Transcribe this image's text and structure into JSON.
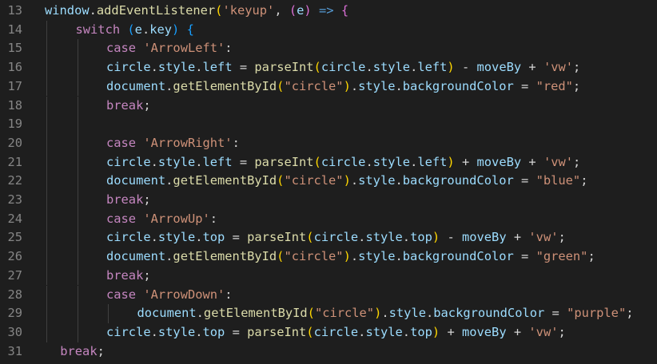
{
  "editor": {
    "first_line_number": 13,
    "lines": [
      {
        "num": "13",
        "indent": 0,
        "tokens": [
          {
            "t": "window",
            "c": "t-var"
          },
          {
            "t": ".",
            "c": "t-pun"
          },
          {
            "t": "addEventListener",
            "c": "t-fn"
          },
          {
            "t": "(",
            "c": "t-br1"
          },
          {
            "t": "'keyup'",
            "c": "t-str"
          },
          {
            "t": ", ",
            "c": "t-pun"
          },
          {
            "t": "(",
            "c": "t-br2"
          },
          {
            "t": "e",
            "c": "t-var"
          },
          {
            "t": ")",
            "c": "t-br2"
          },
          {
            "t": " ",
            "c": "t-pun"
          },
          {
            "t": "=>",
            "c": "t-dec"
          },
          {
            "t": " ",
            "c": "t-pun"
          },
          {
            "t": "{",
            "c": "t-br2"
          }
        ]
      },
      {
        "num": "14",
        "indent": 1,
        "tokens": [
          {
            "t": "switch",
            "c": "t-kw"
          },
          {
            "t": " ",
            "c": "t-pun"
          },
          {
            "t": "(",
            "c": "t-br3"
          },
          {
            "t": "e",
            "c": "t-var"
          },
          {
            "t": ".",
            "c": "t-pun"
          },
          {
            "t": "key",
            "c": "t-var"
          },
          {
            "t": ")",
            "c": "t-br3"
          },
          {
            "t": " ",
            "c": "t-pun"
          },
          {
            "t": "{",
            "c": "t-br3"
          }
        ]
      },
      {
        "num": "15",
        "indent": 2,
        "tokens": [
          {
            "t": "case",
            "c": "t-kw"
          },
          {
            "t": " ",
            "c": "t-pun"
          },
          {
            "t": "'ArrowLeft'",
            "c": "t-str"
          },
          {
            "t": ":",
            "c": "t-pun"
          }
        ]
      },
      {
        "num": "16",
        "indent": 2,
        "tokens": [
          {
            "t": "circle",
            "c": "t-var"
          },
          {
            "t": ".",
            "c": "t-pun"
          },
          {
            "t": "style",
            "c": "t-var"
          },
          {
            "t": ".",
            "c": "t-pun"
          },
          {
            "t": "left",
            "c": "t-var"
          },
          {
            "t": " = ",
            "c": "t-pun"
          },
          {
            "t": "parseInt",
            "c": "t-fn"
          },
          {
            "t": "(",
            "c": "t-br1"
          },
          {
            "t": "circle",
            "c": "t-var"
          },
          {
            "t": ".",
            "c": "t-pun"
          },
          {
            "t": "style",
            "c": "t-var"
          },
          {
            "t": ".",
            "c": "t-pun"
          },
          {
            "t": "left",
            "c": "t-var"
          },
          {
            "t": ")",
            "c": "t-br1"
          },
          {
            "t": " - ",
            "c": "t-pun"
          },
          {
            "t": "moveBy",
            "c": "t-var"
          },
          {
            "t": " + ",
            "c": "t-pun"
          },
          {
            "t": "'vw'",
            "c": "t-str"
          },
          {
            "t": ";",
            "c": "t-pun"
          }
        ]
      },
      {
        "num": "17",
        "indent": 2,
        "tokens": [
          {
            "t": "document",
            "c": "t-var"
          },
          {
            "t": ".",
            "c": "t-pun"
          },
          {
            "t": "getElementById",
            "c": "t-fn"
          },
          {
            "t": "(",
            "c": "t-br1"
          },
          {
            "t": "\"circle\"",
            "c": "t-str"
          },
          {
            "t": ")",
            "c": "t-br1"
          },
          {
            "t": ".",
            "c": "t-pun"
          },
          {
            "t": "style",
            "c": "t-var"
          },
          {
            "t": ".",
            "c": "t-pun"
          },
          {
            "t": "backgroundColor",
            "c": "t-var"
          },
          {
            "t": " = ",
            "c": "t-pun"
          },
          {
            "t": "\"red\"",
            "c": "t-str"
          },
          {
            "t": ";",
            "c": "t-pun"
          }
        ]
      },
      {
        "num": "18",
        "indent": 2,
        "tokens": [
          {
            "t": "break",
            "c": "t-kw"
          },
          {
            "t": ";",
            "c": "t-pun"
          }
        ]
      },
      {
        "num": "19",
        "indent": 2,
        "tokens": []
      },
      {
        "num": "20",
        "indent": 2,
        "tokens": [
          {
            "t": "case",
            "c": "t-kw"
          },
          {
            "t": " ",
            "c": "t-pun"
          },
          {
            "t": "'ArrowRight'",
            "c": "t-str"
          },
          {
            "t": ":",
            "c": "t-pun"
          }
        ]
      },
      {
        "num": "21",
        "indent": 2,
        "tokens": [
          {
            "t": "circle",
            "c": "t-var"
          },
          {
            "t": ".",
            "c": "t-pun"
          },
          {
            "t": "style",
            "c": "t-var"
          },
          {
            "t": ".",
            "c": "t-pun"
          },
          {
            "t": "left",
            "c": "t-var"
          },
          {
            "t": " = ",
            "c": "t-pun"
          },
          {
            "t": "parseInt",
            "c": "t-fn"
          },
          {
            "t": "(",
            "c": "t-br1"
          },
          {
            "t": "circle",
            "c": "t-var"
          },
          {
            "t": ".",
            "c": "t-pun"
          },
          {
            "t": "style",
            "c": "t-var"
          },
          {
            "t": ".",
            "c": "t-pun"
          },
          {
            "t": "left",
            "c": "t-var"
          },
          {
            "t": ")",
            "c": "t-br1"
          },
          {
            "t": " + ",
            "c": "t-pun"
          },
          {
            "t": "moveBy",
            "c": "t-var"
          },
          {
            "t": " + ",
            "c": "t-pun"
          },
          {
            "t": "'vw'",
            "c": "t-str"
          },
          {
            "t": ";",
            "c": "t-pun"
          }
        ]
      },
      {
        "num": "22",
        "indent": 2,
        "tokens": [
          {
            "t": "document",
            "c": "t-var"
          },
          {
            "t": ".",
            "c": "t-pun"
          },
          {
            "t": "getElementById",
            "c": "t-fn"
          },
          {
            "t": "(",
            "c": "t-br1"
          },
          {
            "t": "\"circle\"",
            "c": "t-str"
          },
          {
            "t": ")",
            "c": "t-br1"
          },
          {
            "t": ".",
            "c": "t-pun"
          },
          {
            "t": "style",
            "c": "t-var"
          },
          {
            "t": ".",
            "c": "t-pun"
          },
          {
            "t": "backgroundColor",
            "c": "t-var"
          },
          {
            "t": " = ",
            "c": "t-pun"
          },
          {
            "t": "\"blue\"",
            "c": "t-str"
          },
          {
            "t": ";",
            "c": "t-pun"
          }
        ]
      },
      {
        "num": "23",
        "indent": 2,
        "tokens": [
          {
            "t": "break",
            "c": "t-kw"
          },
          {
            "t": ";",
            "c": "t-pun"
          }
        ]
      },
      {
        "num": "24",
        "indent": 2,
        "tokens": [
          {
            "t": "case",
            "c": "t-kw"
          },
          {
            "t": " ",
            "c": "t-pun"
          },
          {
            "t": "'ArrowUp'",
            "c": "t-str"
          },
          {
            "t": ":",
            "c": "t-pun"
          }
        ]
      },
      {
        "num": "25",
        "indent": 2,
        "tokens": [
          {
            "t": "circle",
            "c": "t-var"
          },
          {
            "t": ".",
            "c": "t-pun"
          },
          {
            "t": "style",
            "c": "t-var"
          },
          {
            "t": ".",
            "c": "t-pun"
          },
          {
            "t": "top",
            "c": "t-var"
          },
          {
            "t": " = ",
            "c": "t-pun"
          },
          {
            "t": "parseInt",
            "c": "t-fn"
          },
          {
            "t": "(",
            "c": "t-br1"
          },
          {
            "t": "circle",
            "c": "t-var"
          },
          {
            "t": ".",
            "c": "t-pun"
          },
          {
            "t": "style",
            "c": "t-var"
          },
          {
            "t": ".",
            "c": "t-pun"
          },
          {
            "t": "top",
            "c": "t-var"
          },
          {
            "t": ")",
            "c": "t-br1"
          },
          {
            "t": " - ",
            "c": "t-pun"
          },
          {
            "t": "moveBy",
            "c": "t-var"
          },
          {
            "t": " + ",
            "c": "t-pun"
          },
          {
            "t": "'vw'",
            "c": "t-str"
          },
          {
            "t": ";",
            "c": "t-pun"
          }
        ]
      },
      {
        "num": "26",
        "indent": 2,
        "tokens": [
          {
            "t": "document",
            "c": "t-var"
          },
          {
            "t": ".",
            "c": "t-pun"
          },
          {
            "t": "getElementById",
            "c": "t-fn"
          },
          {
            "t": "(",
            "c": "t-br1"
          },
          {
            "t": "\"circle\"",
            "c": "t-str"
          },
          {
            "t": ")",
            "c": "t-br1"
          },
          {
            "t": ".",
            "c": "t-pun"
          },
          {
            "t": "style",
            "c": "t-var"
          },
          {
            "t": ".",
            "c": "t-pun"
          },
          {
            "t": "backgroundColor",
            "c": "t-var"
          },
          {
            "t": " = ",
            "c": "t-pun"
          },
          {
            "t": "\"green\"",
            "c": "t-str"
          },
          {
            "t": ";",
            "c": "t-pun"
          }
        ]
      },
      {
        "num": "27",
        "indent": 2,
        "tokens": [
          {
            "t": "break",
            "c": "t-kw"
          },
          {
            "t": ";",
            "c": "t-pun"
          }
        ]
      },
      {
        "num": "28",
        "indent": 2,
        "tokens": [
          {
            "t": "case",
            "c": "t-kw"
          },
          {
            "t": " ",
            "c": "t-pun"
          },
          {
            "t": "'ArrowDown'",
            "c": "t-str"
          },
          {
            "t": ":",
            "c": "t-pun"
          }
        ]
      },
      {
        "num": "29",
        "indent": 3,
        "tokens": [
          {
            "t": "document",
            "c": "t-var"
          },
          {
            "t": ".",
            "c": "t-pun"
          },
          {
            "t": "getElementById",
            "c": "t-fn"
          },
          {
            "t": "(",
            "c": "t-br1"
          },
          {
            "t": "\"circle\"",
            "c": "t-str"
          },
          {
            "t": ")",
            "c": "t-br1"
          },
          {
            "t": ".",
            "c": "t-pun"
          },
          {
            "t": "style",
            "c": "t-var"
          },
          {
            "t": ".",
            "c": "t-pun"
          },
          {
            "t": "backgroundColor",
            "c": "t-var"
          },
          {
            "t": " = ",
            "c": "t-pun"
          },
          {
            "t": "\"purple\"",
            "c": "t-str"
          },
          {
            "t": ";",
            "c": "t-pun"
          }
        ]
      },
      {
        "num": "30",
        "indent": 2,
        "tokens": [
          {
            "t": "circle",
            "c": "t-var"
          },
          {
            "t": ".",
            "c": "t-pun"
          },
          {
            "t": "style",
            "c": "t-var"
          },
          {
            "t": ".",
            "c": "t-pun"
          },
          {
            "t": "top",
            "c": "t-var"
          },
          {
            "t": " = ",
            "c": "t-pun"
          },
          {
            "t": "parseInt",
            "c": "t-fn"
          },
          {
            "t": "(",
            "c": "t-br1"
          },
          {
            "t": "circle",
            "c": "t-var"
          },
          {
            "t": ".",
            "c": "t-pun"
          },
          {
            "t": "style",
            "c": "t-var"
          },
          {
            "t": ".",
            "c": "t-pun"
          },
          {
            "t": "top",
            "c": "t-var"
          },
          {
            "t": ")",
            "c": "t-br1"
          },
          {
            "t": " + ",
            "c": "t-pun"
          },
          {
            "t": "moveBy",
            "c": "t-var"
          },
          {
            "t": " + ",
            "c": "t-pun"
          },
          {
            "t": "'vw'",
            "c": "t-str"
          },
          {
            "t": ";",
            "c": "t-pun"
          }
        ]
      },
      {
        "num": "31",
        "indent": 0.5,
        "tokens": [
          {
            "t": "break",
            "c": "t-kw"
          },
          {
            "t": ";",
            "c": "t-pun"
          }
        ]
      }
    ]
  }
}
